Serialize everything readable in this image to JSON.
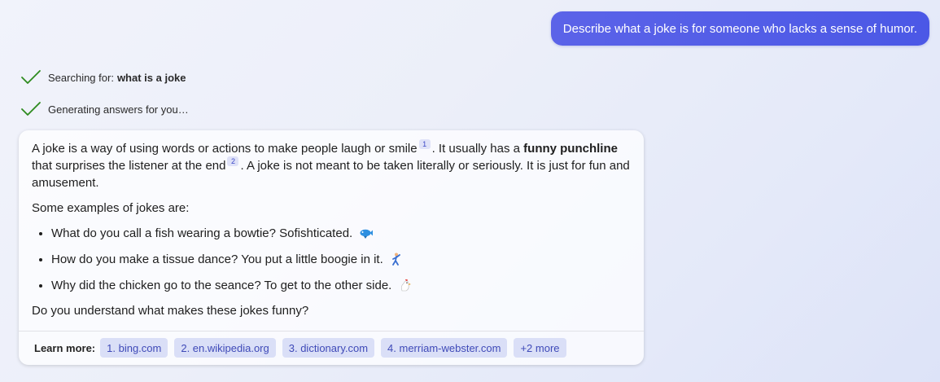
{
  "user_message": "Describe what a joke is for someone who lacks a sense of humor.",
  "status": {
    "searching_prefix": "Searching for:",
    "searching_query": "what is a joke",
    "generating": "Generating answers for you…"
  },
  "answer": {
    "p1_a": "A joke is a way of using words or actions to make people laugh or smile",
    "cite1": "1",
    "p1_b": ". It usually has a",
    "p1_bold": "funny punchline",
    "p1_c": "that surprises the listener at the end",
    "cite2": "2",
    "p1_d": ". A joke is not meant to be taken literally or seriously. It is just for fun and amusement.",
    "p2": "Some examples of jokes are:",
    "jokes": [
      {
        "text": "What do you call a fish wearing a bowtie? Sofishticated.",
        "emoji": "fish-icon"
      },
      {
        "text": "How do you make a tissue dance? You put a little boogie in it.",
        "emoji": "dancer-icon"
      },
      {
        "text": "Why did the chicken go to the seance? To get to the other side.",
        "emoji": "chicken-icon"
      }
    ],
    "p3": "Do you understand what makes these jokes funny?"
  },
  "learn_more": {
    "label": "Learn more:",
    "sources": [
      "1. bing.com",
      "2. en.wikipedia.org",
      "3. dictionary.com",
      "4. merriam-webster.com",
      "+2 more"
    ]
  },
  "colors": {
    "user_bubble": "#4b58e6",
    "check": "#2e8b1e",
    "chip_bg": "#dadff7",
    "chip_text": "#3f4ab8"
  }
}
